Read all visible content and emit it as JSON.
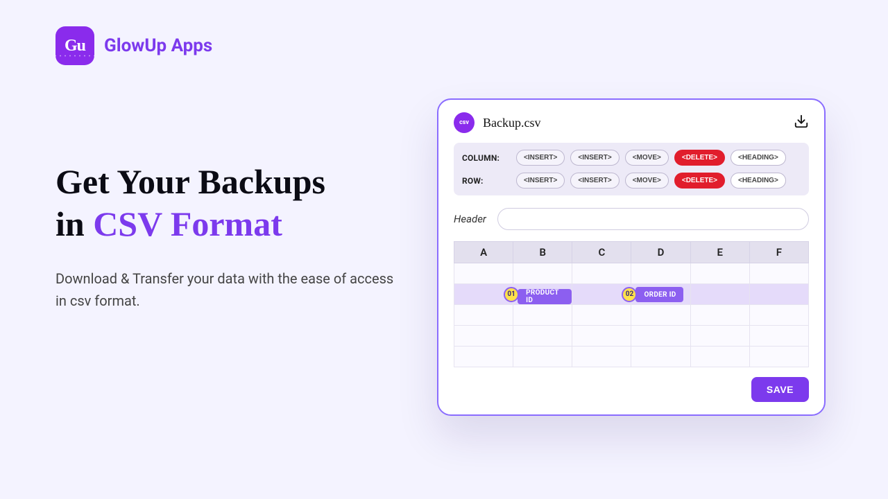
{
  "brand": {
    "name": "GlowUp Apps",
    "badge_text": "Gu"
  },
  "hero": {
    "title_line1": "Get Your Backups",
    "title_line2_prefix": "in ",
    "title_line2_accent": "CSV Format",
    "subtitle": "Download & Transfer your data with the ease of access in csv format."
  },
  "card": {
    "file_name": "Backup.csv",
    "csv_badge": "csv",
    "column_label": "COLUMN:",
    "row_label": "ROW:",
    "column_actions": [
      "<INSERT>",
      "<INSERT>",
      "<MOVE>",
      "<DELETE>",
      "<HEADING>"
    ],
    "row_actions": [
      "<INSERT>",
      "<INSERT>",
      "<MOVE>",
      "<DELETE>",
      "<HEADING>"
    ],
    "header_label": "Header",
    "header_value": "",
    "columns": [
      "A",
      "B",
      "C",
      "D",
      "E",
      "F"
    ],
    "chips": [
      {
        "num": "01",
        "label": "PRODUCT ID"
      },
      {
        "num": "02",
        "label": "ORDER ID"
      }
    ],
    "save_label": "SAVE"
  }
}
